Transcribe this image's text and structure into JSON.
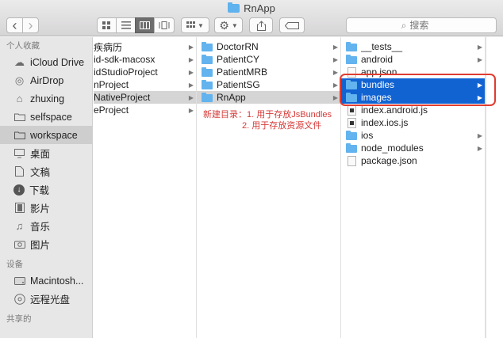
{
  "window": {
    "title": "RnApp"
  },
  "toolbar": {
    "back_glyph": "‹",
    "forward_glyph": "›",
    "search_placeholder": "搜索",
    "view_modes": [
      "icon",
      "list",
      "column",
      "cover-flow"
    ],
    "selected_view": "column"
  },
  "sidebar": {
    "sections": [
      {
        "label": "个人收藏",
        "items": [
          {
            "label": "iCloud Drive",
            "icon": "cloud-icon"
          },
          {
            "label": "AirDrop",
            "icon": "airdrop-icon"
          },
          {
            "label": "zhuxing",
            "icon": "home-icon"
          },
          {
            "label": "selfspace",
            "icon": "folder-icon"
          },
          {
            "label": "workspace",
            "icon": "folder-icon",
            "selected": true
          },
          {
            "label": "桌面",
            "icon": "desktop-icon"
          },
          {
            "label": "文稿",
            "icon": "document-icon"
          },
          {
            "label": "下载",
            "icon": "download-icon"
          },
          {
            "label": "影片",
            "icon": "movie-icon"
          },
          {
            "label": "音乐",
            "icon": "music-icon"
          },
          {
            "label": "图片",
            "icon": "camera-icon"
          }
        ]
      },
      {
        "label": "设备",
        "items": [
          {
            "label": "Macintosh...",
            "icon": "disk-icon"
          },
          {
            "label": "远程光盘",
            "icon": "disc-icon"
          }
        ]
      },
      {
        "label": "共享的",
        "items": []
      }
    ]
  },
  "columns": [
    {
      "items": [
        {
          "label": "疾病历",
          "arrow": true
        },
        {
          "label": "id-sdk-macosx",
          "arrow": true
        },
        {
          "label": "idStudioProject",
          "arrow": true
        },
        {
          "label": "nProject",
          "arrow": true
        },
        {
          "label": "NativeProject",
          "arrow": true,
          "state": "gray"
        },
        {
          "label": "eProject",
          "arrow": true
        }
      ]
    },
    {
      "items": [
        {
          "label": "DoctorRN",
          "type": "folder",
          "arrow": true
        },
        {
          "label": "PatientCY",
          "type": "folder",
          "arrow": true
        },
        {
          "label": "PatientMRB",
          "type": "folder",
          "arrow": true
        },
        {
          "label": "PatientSG",
          "type": "folder",
          "arrow": true
        },
        {
          "label": "RnApp",
          "type": "folder",
          "arrow": true,
          "state": "gray"
        }
      ]
    },
    {
      "items": [
        {
          "label": "__tests__",
          "type": "folder",
          "arrow": true
        },
        {
          "label": "android",
          "type": "folder",
          "arrow": true
        },
        {
          "label": "app.json",
          "type": "file",
          "arrow": false
        },
        {
          "label": "bundles",
          "type": "folder",
          "arrow": true,
          "state": "blue"
        },
        {
          "label": "images",
          "type": "folder",
          "arrow": true,
          "state": "blue"
        },
        {
          "label": "index.android.js",
          "type": "file-dark",
          "arrow": false
        },
        {
          "label": "index.ios.js",
          "type": "file-dark",
          "arrow": false
        },
        {
          "label": "ios",
          "type": "folder",
          "arrow": true
        },
        {
          "label": "node_modules",
          "type": "folder",
          "arrow": true
        },
        {
          "label": "package.json",
          "type": "file",
          "arrow": false
        }
      ]
    }
  ],
  "annotation": {
    "line1": "新建目录：1. 用于存放JsBundles",
    "line2": "2. 用于存放资源文件"
  },
  "colors": {
    "selection_blue": "#1163d2",
    "annotation_red": "#d53a37",
    "highlight_box": "#e03c30"
  }
}
